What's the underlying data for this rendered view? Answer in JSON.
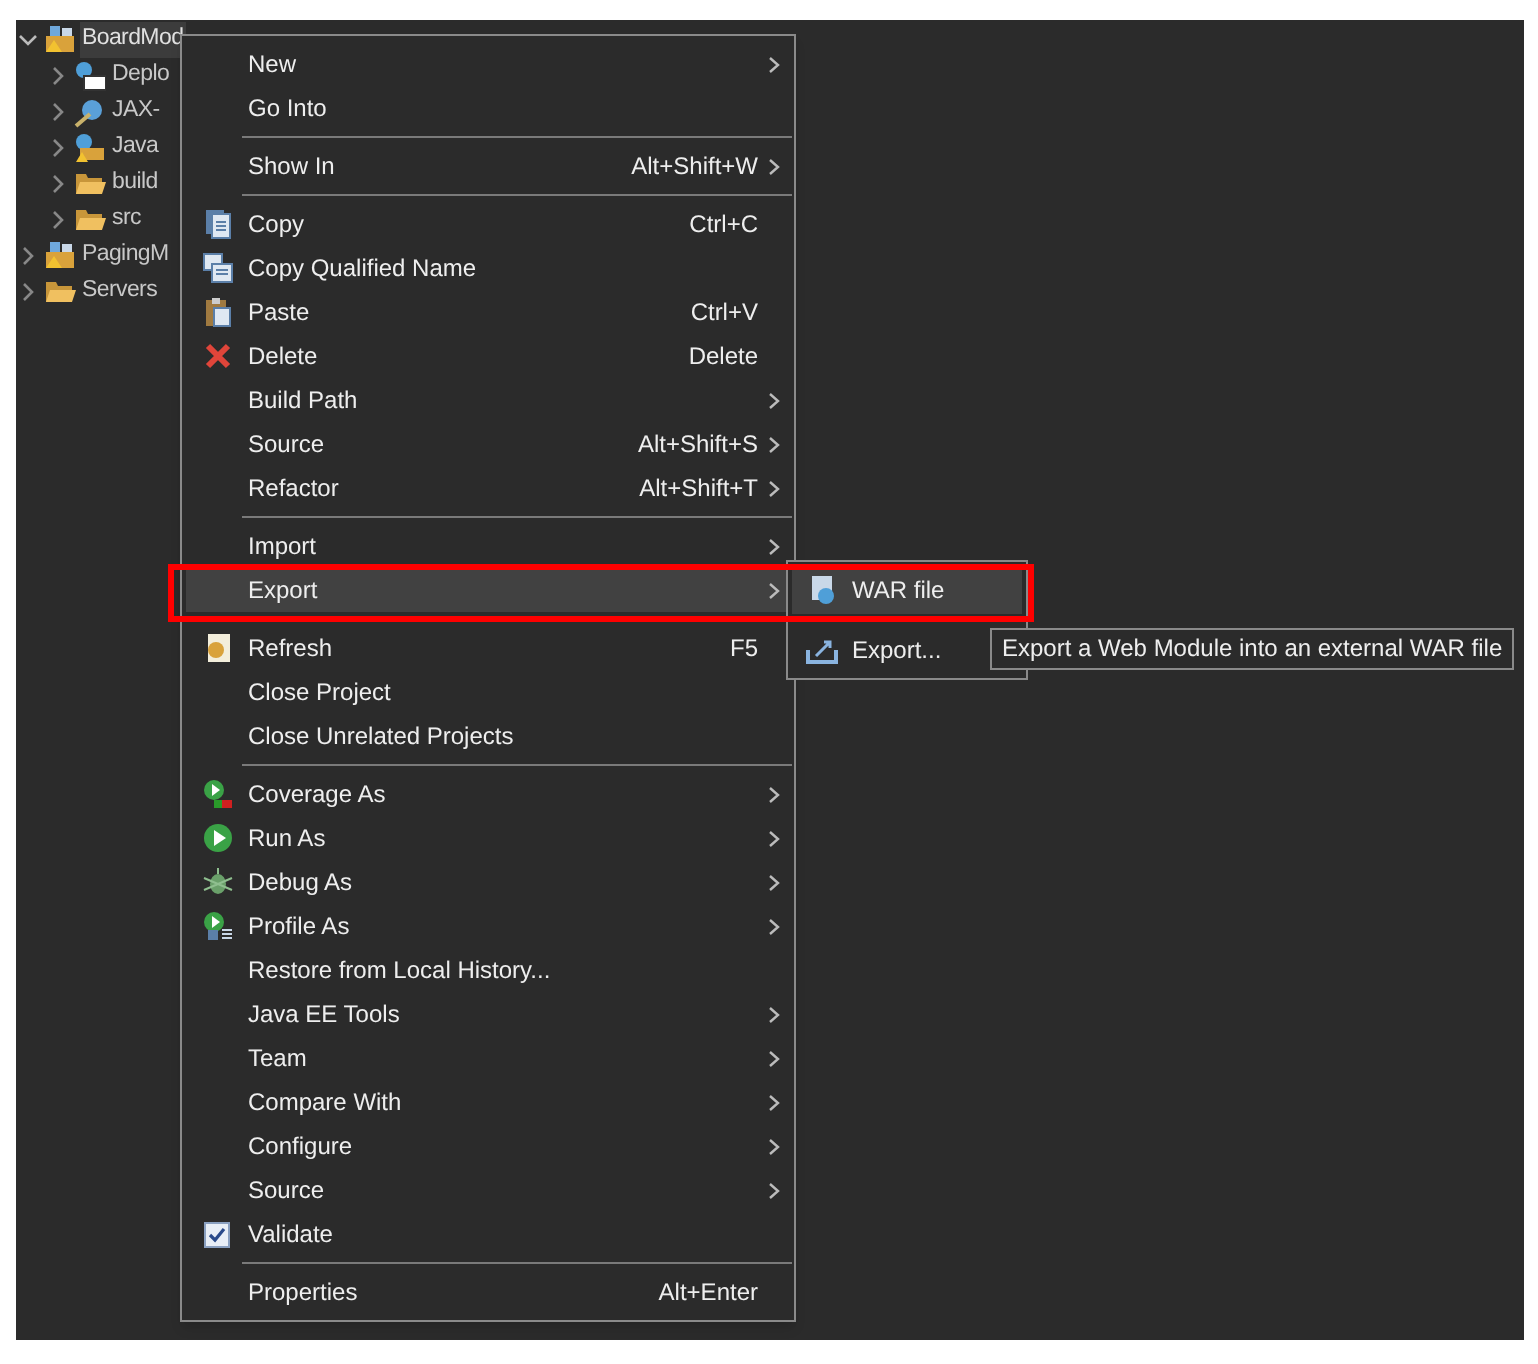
{
  "tree": [
    {
      "label": "BoardMod",
      "expanded": true,
      "selected": true,
      "kind": "project",
      "children": [
        {
          "label": "Deplo",
          "expanded": false,
          "selected": false,
          "kind": "descriptor"
        },
        {
          "label": "JAX-",
          "expanded": false,
          "selected": false,
          "kind": "webservice"
        },
        {
          "label": "Java",
          "expanded": false,
          "selected": false,
          "kind": "resources"
        },
        {
          "label": "build",
          "expanded": false,
          "selected": false,
          "kind": "folder"
        },
        {
          "label": "src",
          "expanded": false,
          "selected": false,
          "kind": "folder"
        }
      ]
    },
    {
      "label": "PagingM",
      "expanded": false,
      "selected": false,
      "kind": "project"
    },
    {
      "label": "Servers",
      "expanded": false,
      "selected": false,
      "kind": "folder"
    }
  ],
  "context_menu": [
    {
      "kind": "plain",
      "label": "New",
      "submenu": true,
      "selected": false
    },
    {
      "kind": "plain",
      "label": "Go Into",
      "selected": false
    },
    {
      "kind": "separator"
    },
    {
      "kind": "plain",
      "label": "Show In",
      "shortcut": "Alt+Shift+W",
      "submenu": true,
      "selected": false
    },
    {
      "kind": "separator"
    },
    {
      "kind": "copy",
      "label": "Copy",
      "shortcut": "Ctrl+C",
      "selected": false
    },
    {
      "kind": "copy2",
      "label": "Copy Qualified Name",
      "selected": false
    },
    {
      "kind": "paste",
      "label": "Paste",
      "shortcut": "Ctrl+V",
      "selected": false
    },
    {
      "kind": "delete",
      "label": "Delete",
      "shortcut": "Delete",
      "selected": false
    },
    {
      "kind": "plain",
      "label": "Build Path",
      "submenu": true,
      "selected": false
    },
    {
      "kind": "plain",
      "label": "Source",
      "shortcut": "Alt+Shift+S",
      "submenu": true,
      "selected": false
    },
    {
      "kind": "plain",
      "label": "Refactor",
      "shortcut": "Alt+Shift+T",
      "submenu": true,
      "selected": false
    },
    {
      "kind": "separator"
    },
    {
      "kind": "plain",
      "label": "Import",
      "submenu": true,
      "selected": false
    },
    {
      "kind": "plain",
      "label": "Export",
      "submenu": true,
      "selected": true
    },
    {
      "kind": "separator"
    },
    {
      "kind": "refresh",
      "label": "Refresh",
      "shortcut": "F5",
      "selected": false
    },
    {
      "kind": "plain",
      "label": "Close Project",
      "selected": false
    },
    {
      "kind": "plain",
      "label": "Close Unrelated Projects",
      "selected": false
    },
    {
      "kind": "separator"
    },
    {
      "kind": "coverage",
      "label": "Coverage As",
      "submenu": true,
      "selected": false
    },
    {
      "kind": "run",
      "label": "Run As",
      "submenu": true,
      "selected": false
    },
    {
      "kind": "debug",
      "label": "Debug As",
      "submenu": true,
      "selected": false
    },
    {
      "kind": "profile",
      "label": "Profile As",
      "submenu": true,
      "selected": false
    },
    {
      "kind": "plain",
      "label": "Restore from Local History...",
      "selected": false
    },
    {
      "kind": "plain",
      "label": "Java EE Tools",
      "submenu": true,
      "selected": false
    },
    {
      "kind": "plain",
      "label": "Team",
      "submenu": true,
      "selected": false
    },
    {
      "kind": "plain",
      "label": "Compare With",
      "submenu": true,
      "selected": false
    },
    {
      "kind": "plain",
      "label": "Configure",
      "submenu": true,
      "selected": false
    },
    {
      "kind": "plain",
      "label": "Source",
      "submenu": true,
      "selected": false
    },
    {
      "kind": "check",
      "label": "Validate",
      "checked": true,
      "selected": false
    },
    {
      "kind": "separator"
    },
    {
      "kind": "plain",
      "label": "Properties",
      "shortcut": "Alt+Enter",
      "selected": false
    }
  ],
  "export_submenu": [
    {
      "label": "WAR file",
      "kind": "war",
      "selected": true
    },
    {
      "label": "Export...",
      "kind": "export",
      "selected": false
    }
  ],
  "tooltip": "Export a Web Module into an external WAR file"
}
